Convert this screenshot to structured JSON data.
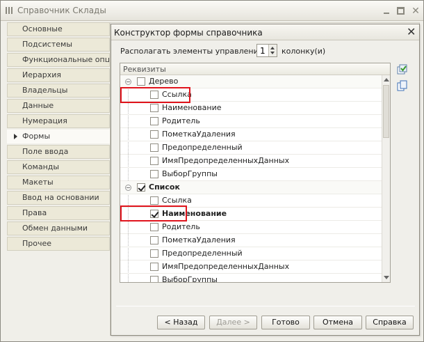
{
  "window": {
    "title": "Справочник Склады"
  },
  "nav": [
    {
      "label": "Основные"
    },
    {
      "label": "Подсистемы"
    },
    {
      "label": "Функциональные опции"
    },
    {
      "label": "Иерархия"
    },
    {
      "label": "Владельцы"
    },
    {
      "label": "Данные"
    },
    {
      "label": "Нумерация"
    },
    {
      "label": "Формы",
      "active": true
    },
    {
      "label": "Поле ввода"
    },
    {
      "label": "Команды"
    },
    {
      "label": "Макеты"
    },
    {
      "label": "Ввод на основании"
    },
    {
      "label": "Права"
    },
    {
      "label": "Обмен данными"
    },
    {
      "label": "Прочее"
    }
  ],
  "dialog": {
    "title": "Конструктор формы справочника",
    "columns_label_before": "Располагать элементы управления в",
    "columns_value": "1",
    "columns_label_after": "колонку(и)",
    "tree_header": "Реквизиты",
    "groups": [
      {
        "label": "Дерево",
        "checked": false,
        "children": [
          {
            "label": "Ссылка",
            "checked": false
          },
          {
            "label": "Наименование",
            "checked": false
          },
          {
            "label": "Родитель",
            "checked": false
          },
          {
            "label": "ПометкаУдаления",
            "checked": false
          },
          {
            "label": "Предопределенный",
            "checked": false
          },
          {
            "label": "ИмяПредопределенныхДанных",
            "checked": false
          },
          {
            "label": "ВыборГруппы",
            "checked": false
          }
        ]
      },
      {
        "label": "Список",
        "checked": true,
        "children": [
          {
            "label": "Ссылка",
            "checked": false
          },
          {
            "label": "Наименование",
            "checked": true
          },
          {
            "label": "Родитель",
            "checked": false
          },
          {
            "label": "ПометкаУдаления",
            "checked": false
          },
          {
            "label": "Предопределенный",
            "checked": false
          },
          {
            "label": "ИмяПредопределенныхДанных",
            "checked": false
          },
          {
            "label": "ВыборГруппы",
            "checked": false
          }
        ]
      }
    ],
    "buttons": {
      "back": "< Назад",
      "next": "Далее >",
      "finish": "Готово",
      "cancel": "Отмена",
      "help": "Справка"
    }
  },
  "colors": {
    "highlight_box": "#e0141d",
    "check_all_icon": "#3a9a2a",
    "copy_icon": "#3d6fb6"
  }
}
